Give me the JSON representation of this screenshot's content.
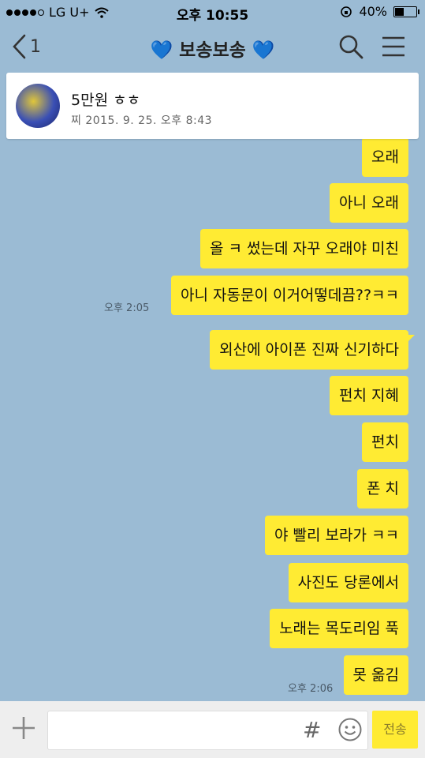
{
  "status_bar": {
    "carrier": "LG U+",
    "time": "오후 10:55",
    "battery": "40%"
  },
  "header": {
    "back_count": "1",
    "title": "보송보송",
    "title_heart": "💙"
  },
  "notice": {
    "title": "5만원 ㅎㅎ",
    "subtitle": "찌 2015. 9. 25. 오후 8:43"
  },
  "messages": [
    {
      "text": "오래"
    },
    {
      "text": "아니 오래"
    },
    {
      "text": "올 ㅋ 썼는데 자꾸 오래야 미친"
    },
    {
      "text": "아니 자동문이 이거어떻데끔??ㅋㅋ",
      "time": "오후 2:05"
    },
    {
      "text": "외산에 아이폰 진짜 신기하다"
    },
    {
      "text": "펀치 지혜"
    },
    {
      "text": "펀치"
    },
    {
      "text": "폰 치"
    },
    {
      "text": "야 빨리 보라가 ㅋㅋ"
    },
    {
      "text": "사진도 당론에서"
    },
    {
      "text": "노래는 목도리임 푹"
    },
    {
      "text": "못 옮김",
      "time": "오후 2:06"
    }
  ],
  "input": {
    "placeholder": "",
    "hash_label": "#",
    "send_label": "전송"
  },
  "colors": {
    "background": "#9bbbd4",
    "bubble": "#ffeb33",
    "heart": "#1e7fe6"
  }
}
